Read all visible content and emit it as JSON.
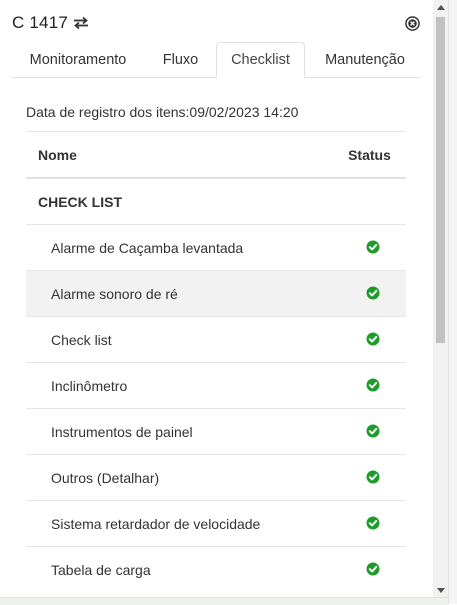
{
  "header": {
    "title": "C 1417",
    "swap_icon": "swap-arrows-icon",
    "close_icon": "close-circle-icon"
  },
  "tabs": [
    {
      "label": "Monitoramento",
      "active": false
    },
    {
      "label": "Fluxo",
      "active": false
    },
    {
      "label": "Checklist",
      "active": true
    },
    {
      "label": "Manutenção",
      "active": false
    }
  ],
  "registration": {
    "text": "Data de registro dos itens:09/02/2023 14:20"
  },
  "table": {
    "columns": {
      "name": "Nome",
      "status": "Status"
    },
    "group": "CHECK LIST",
    "rows": [
      {
        "name": "Alarme de Caçamba levantada",
        "status": "ok"
      },
      {
        "name": "Alarme sonoro de ré",
        "status": "ok"
      },
      {
        "name": "Check list",
        "status": "ok"
      },
      {
        "name": "Inclinômetro",
        "status": "ok"
      },
      {
        "name": "Instrumentos de painel",
        "status": "ok"
      },
      {
        "name": "Outros (Detalhar)",
        "status": "ok"
      },
      {
        "name": "Sistema retardador de velocidade",
        "status": "ok"
      },
      {
        "name": "Tabela de carga",
        "status": "ok"
      }
    ]
  },
  "colors": {
    "ok_green": "#1e9c2a",
    "stripe": "#f2f2f2",
    "border": "#dee2e6"
  }
}
